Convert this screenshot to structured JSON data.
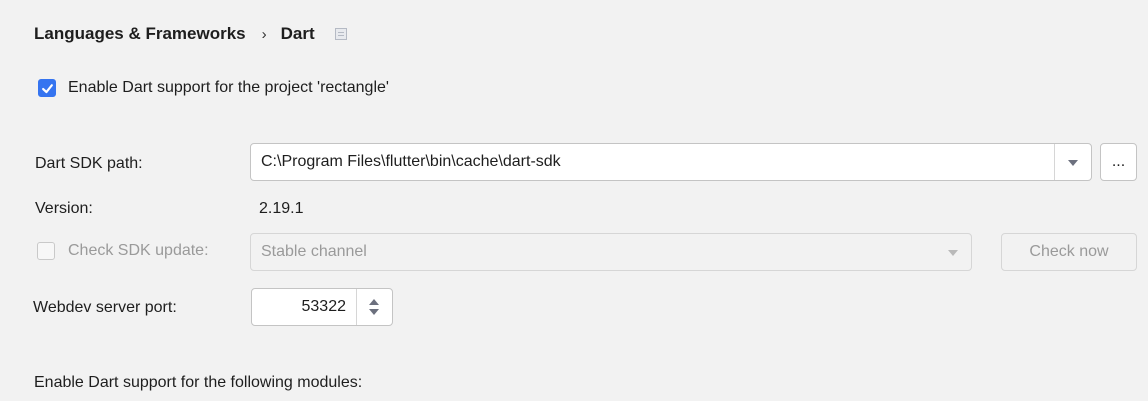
{
  "breadcrumb": {
    "parent": "Languages & Frameworks",
    "separator": "›",
    "current": "Dart"
  },
  "enable_support": {
    "checked": true,
    "label": "Enable Dart support for the project 'rectangle'"
  },
  "sdk_path": {
    "label": "Dart SDK path:",
    "value": "C:\\Program Files\\flutter\\bin\\cache\\dart-sdk",
    "browse_label": "..."
  },
  "version": {
    "label": "Version:",
    "value": "2.19.1"
  },
  "sdk_update": {
    "checked": false,
    "disabled": true,
    "label": "Check SDK update:",
    "channel": "Stable channel",
    "check_now_label": "Check now"
  },
  "webdev_port": {
    "label": "Webdev server port:",
    "value": "53322"
  },
  "modules": {
    "label": "Enable Dart support for the following modules:"
  },
  "colors": {
    "accent": "#3574f0",
    "background": "#f2f2f2",
    "disabled_text": "#9a9a9a"
  }
}
